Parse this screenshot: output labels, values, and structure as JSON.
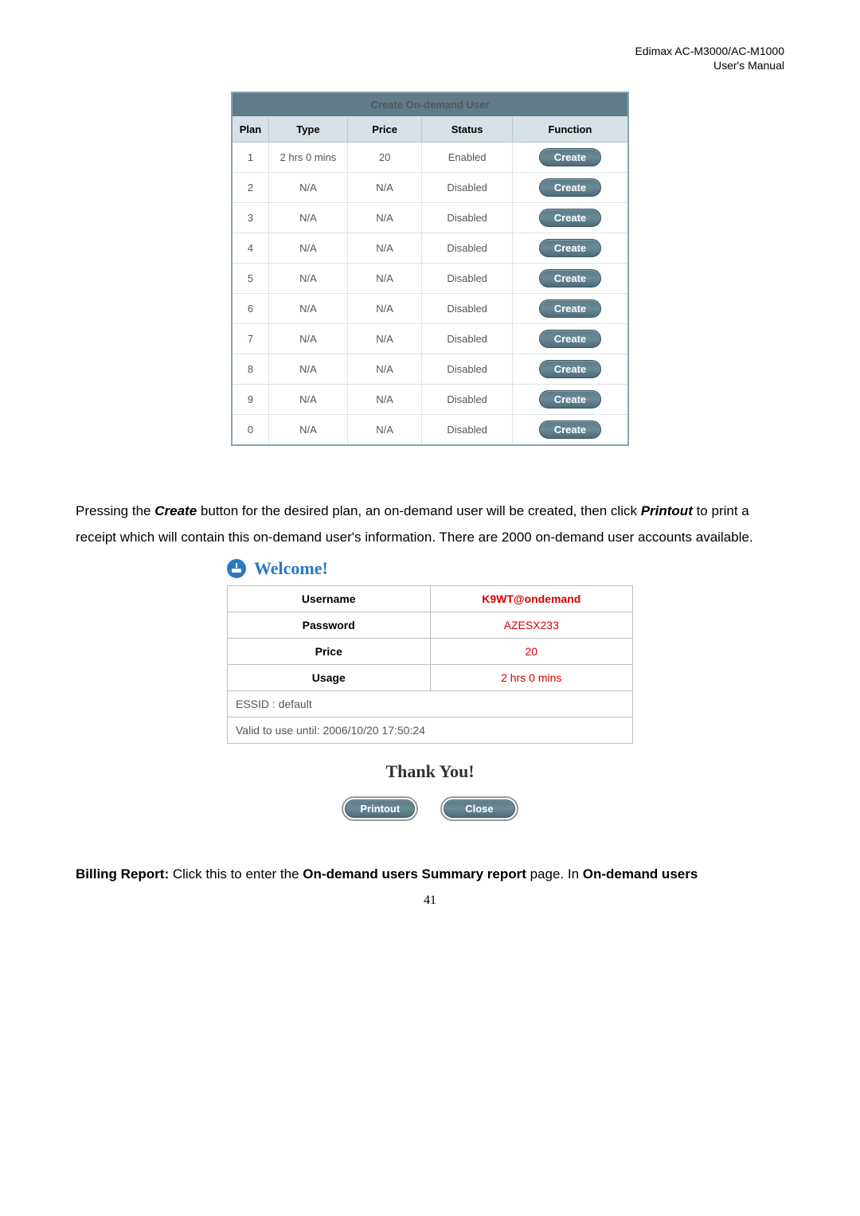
{
  "header": {
    "device": "Edimax  AC-M3000/AC-M1000",
    "doc": "User's  Manual"
  },
  "ondemand": {
    "title": "Create On-demand User",
    "cols": {
      "plan": "Plan",
      "type": "Type",
      "price": "Price",
      "status": "Status",
      "func": "Function"
    },
    "create_label": "Create",
    "rows": [
      {
        "plan": "1",
        "type": "2 hrs 0 mins",
        "price": "20",
        "status": "Enabled"
      },
      {
        "plan": "2",
        "type": "N/A",
        "price": "N/A",
        "status": "Disabled"
      },
      {
        "plan": "3",
        "type": "N/A",
        "price": "N/A",
        "status": "Disabled"
      },
      {
        "plan": "4",
        "type": "N/A",
        "price": "N/A",
        "status": "Disabled"
      },
      {
        "plan": "5",
        "type": "N/A",
        "price": "N/A",
        "status": "Disabled"
      },
      {
        "plan": "6",
        "type": "N/A",
        "price": "N/A",
        "status": "Disabled"
      },
      {
        "plan": "7",
        "type": "N/A",
        "price": "N/A",
        "status": "Disabled"
      },
      {
        "plan": "8",
        "type": "N/A",
        "price": "N/A",
        "status": "Disabled"
      },
      {
        "plan": "9",
        "type": "N/A",
        "price": "N/A",
        "status": "Disabled"
      },
      {
        "plan": "0",
        "type": "N/A",
        "price": "N/A",
        "status": "Disabled"
      }
    ]
  },
  "para1": {
    "t1": "Pressing the ",
    "b1": "Create",
    "t2": " button for the desired plan, an on-demand user will be created, then click ",
    "b2": "Printout",
    "t3": " to print a receipt which will contain this on-demand user's information. There are 2000 on-demand user accounts available."
  },
  "welcome": {
    "title": "Welcome!",
    "fields": {
      "username_label": "Username",
      "username_value": "K9WT@ondemand",
      "password_label": "Password",
      "password_value": "AZESX233",
      "price_label": "Price",
      "price_value": "20",
      "usage_label": "Usage",
      "usage_value": "2 hrs 0 mins"
    },
    "essid": "ESSID : default",
    "valid": "Valid to use until: 2006/10/20 17:50:24",
    "thanks": "Thank You!",
    "printout_btn": "Printout",
    "close_btn": "Close"
  },
  "para2": {
    "b1": "Billing Report:",
    "t1": " Click this to enter the ",
    "b2": "On-demand users Summary report",
    "t2": " page. In ",
    "b3": "On-demand users"
  },
  "page_number": "41"
}
